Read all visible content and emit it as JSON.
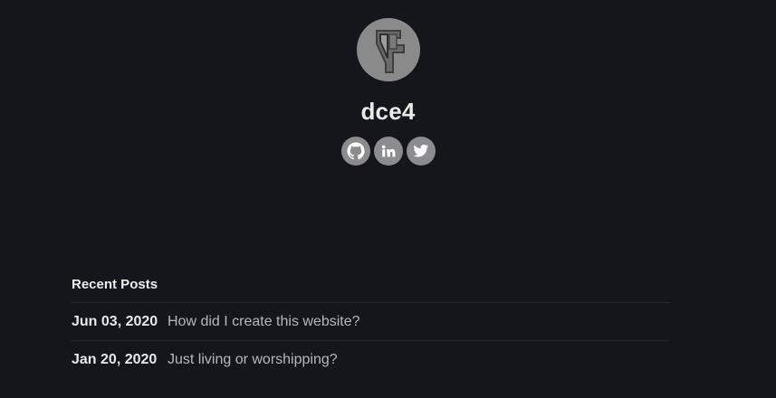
{
  "profile": {
    "name": "dce4",
    "social_links": [
      {
        "icon": "github-icon"
      },
      {
        "icon": "linkedin-icon"
      },
      {
        "icon": "twitter-icon"
      }
    ]
  },
  "recent_posts": {
    "heading": "Recent Posts",
    "items": [
      {
        "date": "Jun 03, 2020",
        "title": "How did I create this website?"
      },
      {
        "date": "Jan 20, 2020",
        "title": "Just living or worshipping?"
      }
    ]
  },
  "colors": {
    "background": "#15161b",
    "avatar": "#8a8a8a",
    "social_bg": "#8c8c8e"
  }
}
